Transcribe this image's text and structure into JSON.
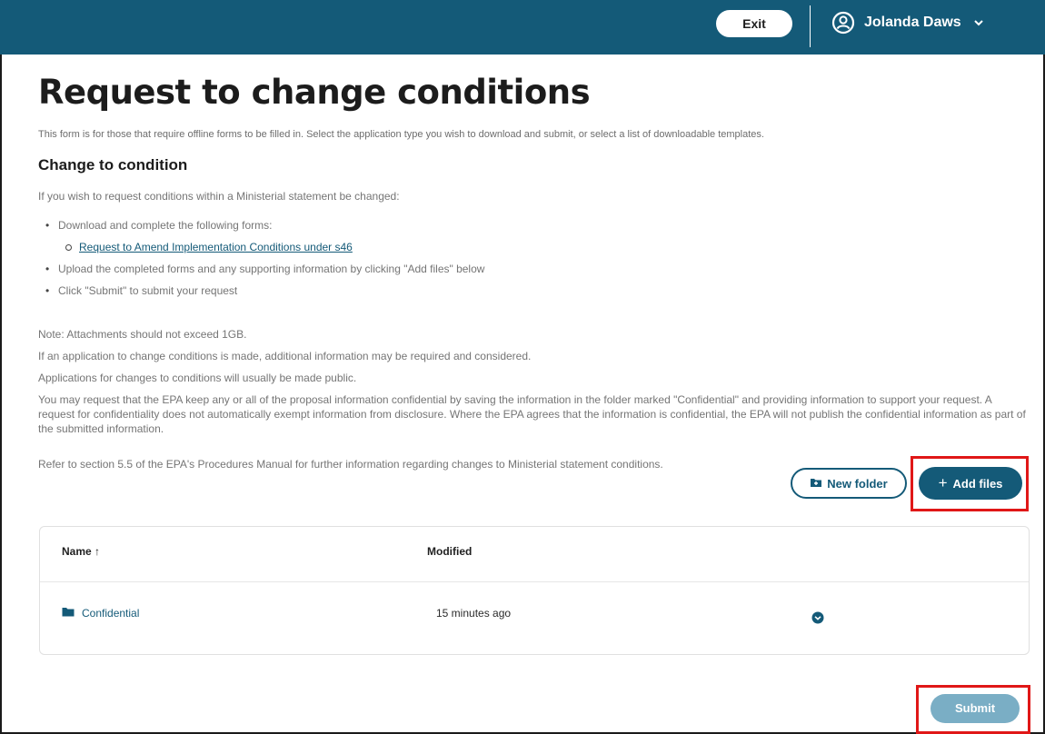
{
  "header": {
    "exit_label": "Exit",
    "user_name": "Jolanda Daws"
  },
  "page": {
    "title": "Request to change conditions",
    "lead": "This form is for those that require offline forms to be filled in. Select the application type you wish to download and submit, or select a list of downloadable templates.",
    "section_heading": "Change to condition",
    "intro": "If you wish to request conditions within a Ministerial statement be changed:",
    "steps": {
      "download": "Download and complete the following forms:",
      "form_link": "Request to Amend Implementation Conditions under s46",
      "upload": "Upload the completed forms and any supporting information by clicking \"Add files\" below",
      "submit": "Click \"Submit\" to submit your request"
    },
    "note": "Note: Attachments should not exceed 1GB.",
    "additional": "If an application to change conditions is made, additional information may be required and considered.",
    "public": "Applications for changes to conditions will usually be made public.",
    "confidential": "You may request that the EPA keep any or all of the proposal information confidential by saving the information in the folder marked \"Confidential\" and providing information to support your request. A request for confidentiality does not automatically exempt information from disclosure. Where the EPA agrees that the information is confidential, the EPA will not publish the confidential information as part of the submitted information.",
    "refer": "Refer to section 5.5 of the EPA's Procedures Manual for further information regarding changes to Ministerial statement conditions."
  },
  "actions": {
    "new_folder": "New folder",
    "add_files": "Add files",
    "add_symbol": "+",
    "submit": "Submit"
  },
  "table": {
    "col_name": "Name",
    "sort_indicator": "↑",
    "col_modified": "Modified",
    "rows": [
      {
        "name": "Confidential",
        "modified": "15 minutes ago"
      }
    ]
  },
  "colors": {
    "primary": "#145a78",
    "highlight": "#e01717",
    "submit_disabled": "#7aaec5"
  }
}
